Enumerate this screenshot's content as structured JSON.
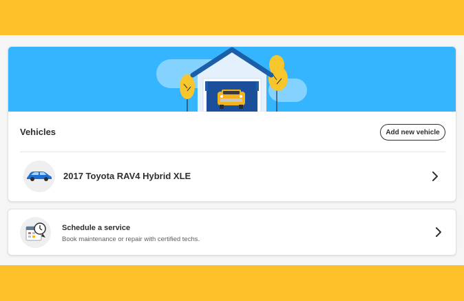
{
  "colors": {
    "band": "#fec12a",
    "hero_sky": "#36b5ff",
    "garage_roof": "#1a5fa8",
    "garage_door": "#1b4f9c",
    "car_yellow": "#f2b31c",
    "tree_yellow": "#f7c52c",
    "vehicle_icon_blue": "#1d6fd1",
    "text_dark": "#2e2e2e"
  },
  "vehicles": {
    "title": "Vehicles",
    "add_button_label": "Add new vehicle",
    "items": [
      {
        "name": "2017 Toyota RAV4 Hybrid XLE",
        "icon": "car-icon"
      }
    ]
  },
  "service": {
    "title": "Schedule a service",
    "description": "Book maintenance or repair with certified techs.",
    "icon": "calendar-clock-icon"
  },
  "icons": {
    "chevron": "chevron-right-icon"
  }
}
